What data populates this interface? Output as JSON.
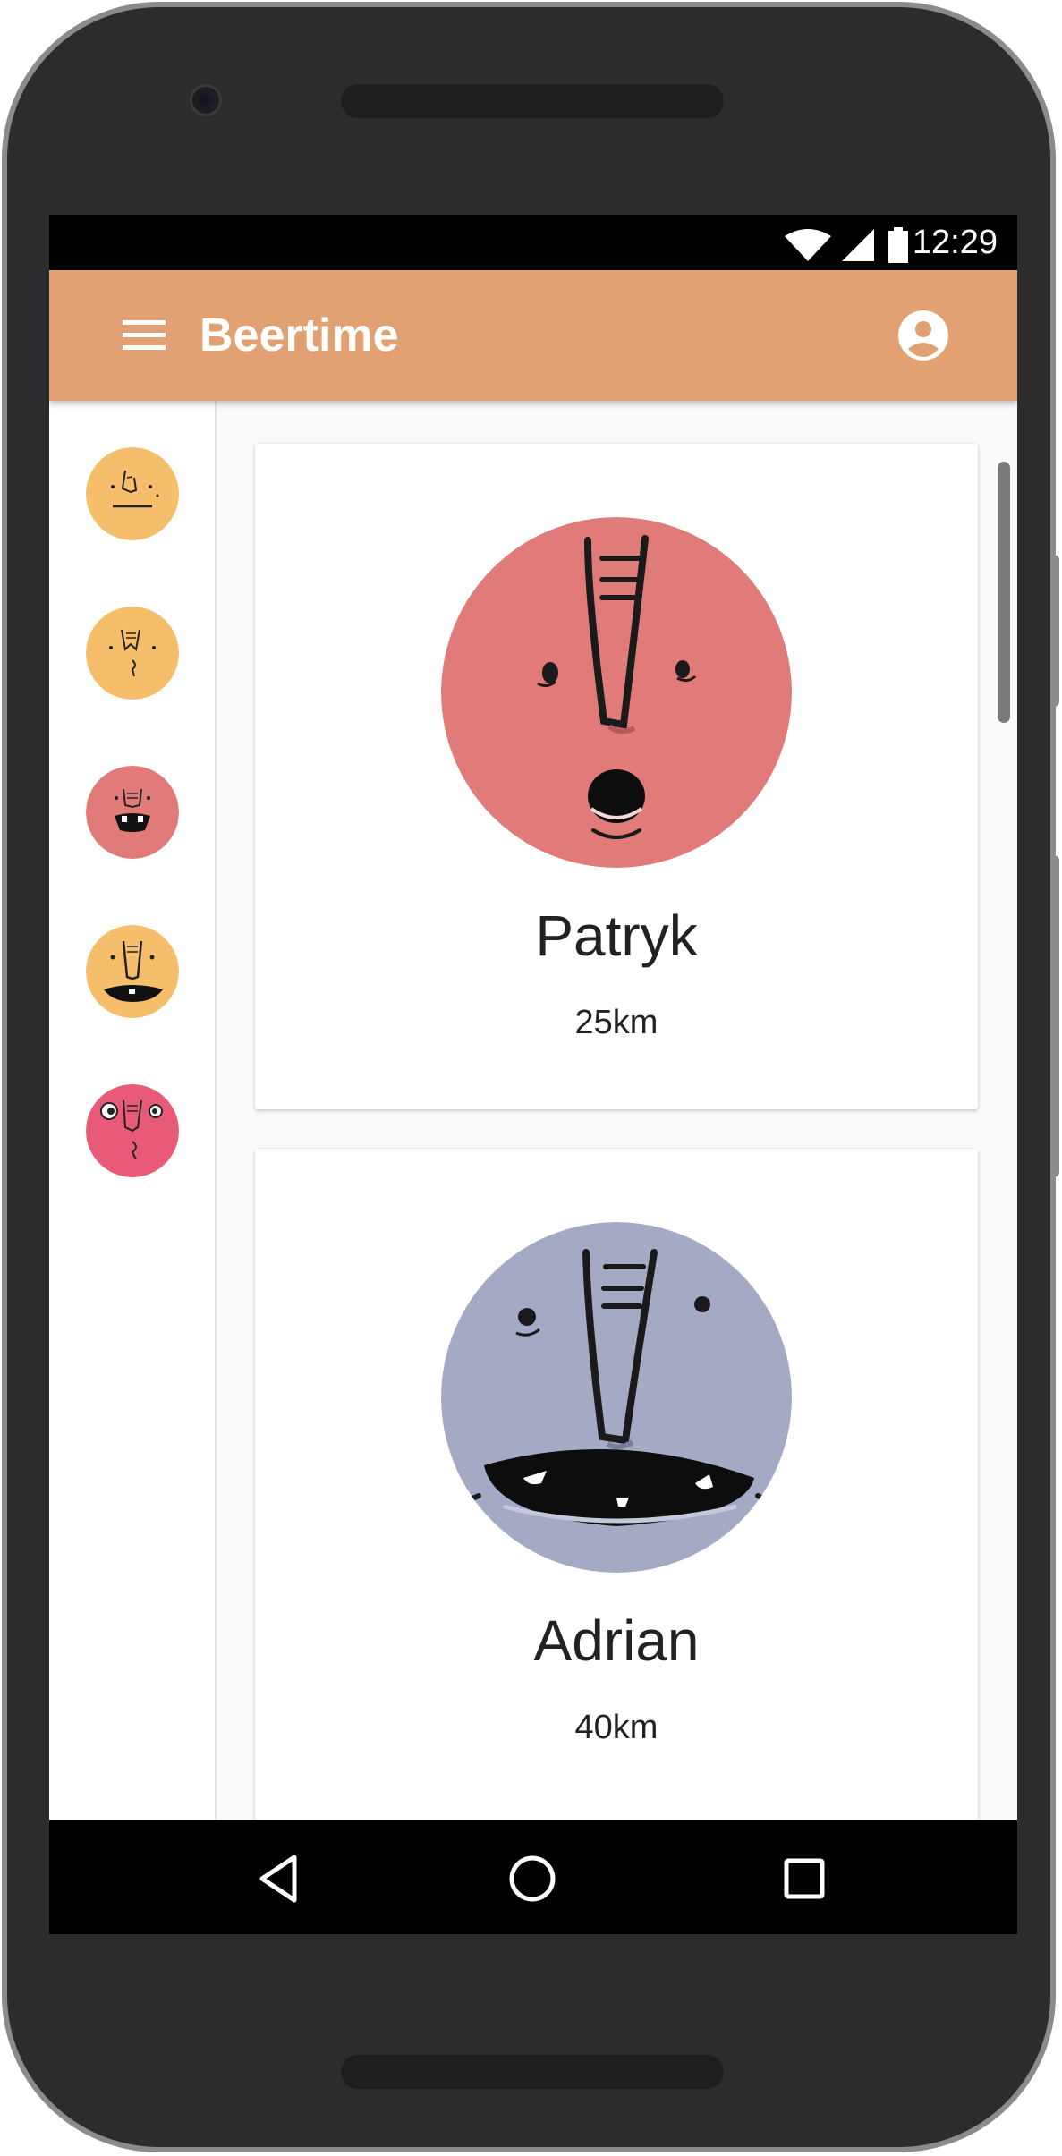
{
  "status_bar": {
    "time": "12:29"
  },
  "app_bar": {
    "title": "Beertime",
    "menu_icon": "hamburger-menu-icon",
    "account_icon": "account-circle-icon",
    "color": "#e2a172"
  },
  "sidebar": {
    "avatars": [
      {
        "color": "#f5be6a",
        "icon": "face-neutral-icon"
      },
      {
        "color": "#f5be6a",
        "icon": "face-bearded-icon"
      },
      {
        "color": "#e07b7a",
        "icon": "face-grin-icon"
      },
      {
        "color": "#f5be6a",
        "icon": "face-smile-icon"
      },
      {
        "color": "#e85a78",
        "icon": "face-surprised-icon"
      }
    ]
  },
  "users": [
    {
      "name": "Patryk",
      "distance": "25km",
      "avatar_color": "#e07b7a"
    },
    {
      "name": "Adrian",
      "distance": "40km",
      "avatar_color": "#a5aac4"
    }
  ],
  "nav_bar": {
    "back_icon": "back-triangle-icon",
    "home_icon": "home-circle-icon",
    "recents_icon": "recents-square-icon"
  }
}
